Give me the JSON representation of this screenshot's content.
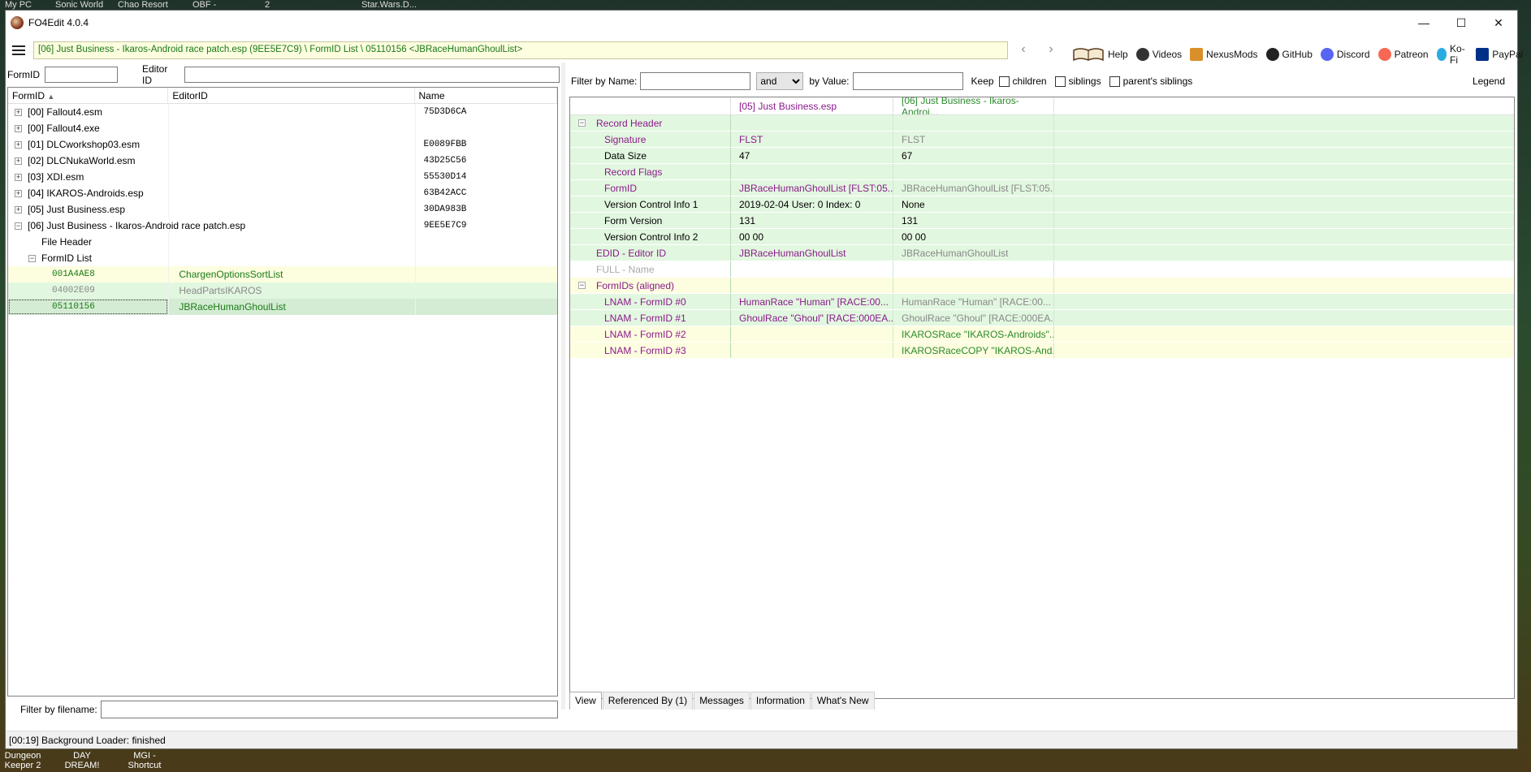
{
  "desktop": {
    "top_labels": [
      "My PC",
      "Sonic World",
      "Chao Resort",
      "OBF -",
      "2",
      "Star.Wars.D..."
    ],
    "bottom_labels": [
      "Dungeon Keeper 2",
      "DAY DREAM!",
      "MGI - Shortcut"
    ]
  },
  "window": {
    "title": "FO4Edit 4.0.4",
    "minimize": "—",
    "maximize": "☐",
    "close": "✕"
  },
  "pathbar": {
    "path": "[06] Just Business - Ikaros-Android race patch.esp (9EE5E7C9) \\ FormID List \\ 05110156 <JBRaceHumanGhoulList>",
    "back": "‹",
    "forward": "›",
    "links": [
      {
        "label": "Help",
        "icon": "book-icon"
      },
      {
        "label": "Videos",
        "icon": "videos-icon"
      },
      {
        "label": "NexusMods",
        "icon": "nexusmods-icon"
      },
      {
        "label": "GitHub",
        "icon": "github-icon"
      },
      {
        "label": "Discord",
        "icon": "discord-icon"
      },
      {
        "label": "Patreon",
        "icon": "patreon-icon"
      },
      {
        "label": "Ko-Fi",
        "icon": "kofi-icon"
      },
      {
        "label": "PayPal",
        "icon": "paypal-icon"
      }
    ]
  },
  "left": {
    "formid_label": "FormID",
    "editorid_label": "Editor ID",
    "formid_value": "",
    "editorid_value": "",
    "columns": [
      "FormID",
      "EditorID",
      "Name"
    ],
    "tree": [
      {
        "exp": "+",
        "label": "[00] Fallout4.esm",
        "editor": "",
        "name": "75D3D6CA",
        "indent": 0,
        "style": ""
      },
      {
        "exp": "+",
        "label": "[00] Fallout4.exe",
        "editor": "",
        "name": "",
        "indent": 0,
        "style": ""
      },
      {
        "exp": "+",
        "label": "[01] DLCworkshop03.esm",
        "editor": "",
        "name": "E0089FBB",
        "indent": 0,
        "style": ""
      },
      {
        "exp": "+",
        "label": "[02] DLCNukaWorld.esm",
        "editor": "",
        "name": "43D25C56",
        "indent": 0,
        "style": ""
      },
      {
        "exp": "+",
        "label": "[03] XDI.esm",
        "editor": "",
        "name": "55530D14",
        "indent": 0,
        "style": ""
      },
      {
        "exp": "+",
        "label": "[04] IKAROS-Androids.esp",
        "editor": "",
        "name": "63B42ACC",
        "indent": 0,
        "style": ""
      },
      {
        "exp": "+",
        "label": "[05] Just Business.esp",
        "editor": "",
        "name": "30DA983B",
        "indent": 0,
        "style": ""
      },
      {
        "exp": "−",
        "label": "[06] Just Business - Ikaros-Android race patch.esp",
        "editor": "",
        "name": "9EE5E7C9",
        "indent": 0,
        "style": ""
      },
      {
        "exp": "",
        "label": "File Header",
        "editor": "",
        "name": "",
        "indent": 1,
        "style": ""
      },
      {
        "exp": "−",
        "label": "FormID List",
        "editor": "",
        "name": "",
        "indent": 1,
        "style": ""
      },
      {
        "exp": "",
        "label": "001A4AE8",
        "editor": "ChargenOptionsSortList",
        "name": "",
        "indent": 2,
        "style": "yellow"
      },
      {
        "exp": "",
        "label": "04002E09",
        "editor": "HeadPartsIKAROS",
        "name": "",
        "indent": 2,
        "style": "green-grey"
      },
      {
        "exp": "",
        "label": "05110156",
        "editor": "JBRaceHumanGhoulList",
        "name": "",
        "indent": 2,
        "style": "selected"
      }
    ],
    "filter_label": "Filter by filename:",
    "filter_value": ""
  },
  "right": {
    "filter_name_label": "Filter by Name:",
    "filter_name_value": "",
    "and_select": "and",
    "filter_value_label": "by Value:",
    "filter_value_value": "",
    "keep_label": "Keep",
    "children_label": "children",
    "siblings_label": "siblings",
    "parents_siblings_label": "parent's siblings",
    "legend_label": "Legend",
    "col_headers": [
      "",
      "[05] Just Business.esp",
      "[06] Just Business - Ikaros-Androi..."
    ],
    "rows": [
      {
        "level": 0,
        "exp": "−",
        "label": "Record Header",
        "v1": "",
        "v2": "",
        "bg": "green",
        "lc": "purple",
        "c1": "",
        "c2": ""
      },
      {
        "level": 1,
        "exp": "",
        "label": "Signature",
        "v1": "FLST",
        "v2": "FLST",
        "bg": "green",
        "lc": "purple",
        "c1": "purple",
        "c2": "grey"
      },
      {
        "level": 1,
        "exp": "",
        "label": "Data Size",
        "v1": "47",
        "v2": "67",
        "bg": "green",
        "lc": "",
        "c1": "",
        "c2": ""
      },
      {
        "level": 1,
        "exp": "",
        "label": "Record Flags",
        "v1": "",
        "v2": "",
        "bg": "green",
        "lc": "purple",
        "c1": "",
        "c2": ""
      },
      {
        "level": 1,
        "exp": "",
        "label": "FormID",
        "v1": "JBRaceHumanGhoulList [FLST:05...",
        "v2": "JBRaceHumanGhoulList [FLST:05...",
        "bg": "green",
        "lc": "purple",
        "c1": "purple",
        "c2": "grey"
      },
      {
        "level": 1,
        "exp": "",
        "label": "Version Control Info 1",
        "v1": "2019-02-04 User: 0 Index: 0",
        "v2": "None",
        "bg": "green",
        "lc": "",
        "c1": "",
        "c2": ""
      },
      {
        "level": 1,
        "exp": "",
        "label": "Form Version",
        "v1": "131",
        "v2": "131",
        "bg": "green",
        "lc": "",
        "c1": "",
        "c2": ""
      },
      {
        "level": 1,
        "exp": "",
        "label": "Version Control Info 2",
        "v1": "00 00",
        "v2": "00 00",
        "bg": "green",
        "lc": "",
        "c1": "",
        "c2": ""
      },
      {
        "level": 0,
        "exp": "",
        "label": "EDID - Editor ID",
        "v1": "JBRaceHumanGhoulList",
        "v2": "JBRaceHumanGhoulList",
        "bg": "green",
        "lc": "purple",
        "c1": "purple",
        "c2": "grey"
      },
      {
        "level": 0,
        "exp": "",
        "label": "FULL - Name",
        "v1": "",
        "v2": "",
        "bg": "white",
        "lc": "grey",
        "c1": "",
        "c2": ""
      },
      {
        "level": 0,
        "exp": "−",
        "label": "FormIDs (aligned)",
        "v1": "",
        "v2": "",
        "bg": "yellow",
        "lc": "purple",
        "c1": "",
        "c2": ""
      },
      {
        "level": 1,
        "exp": "",
        "label": "LNAM - FormID #0",
        "v1": "HumanRace \"Human\" [RACE:00...",
        "v2": "HumanRace \"Human\" [RACE:00...",
        "bg": "green",
        "lc": "purple",
        "c1": "purple",
        "c2": "grey"
      },
      {
        "level": 1,
        "exp": "",
        "label": "LNAM - FormID #1",
        "v1": "GhoulRace \"Ghoul\" [RACE:000EA...",
        "v2": "GhoulRace \"Ghoul\" [RACE:000EA...",
        "bg": "green",
        "lc": "purple",
        "c1": "purple",
        "c2": "grey"
      },
      {
        "level": 1,
        "exp": "",
        "label": "LNAM - FormID #2",
        "v1": "",
        "v2": "IKAROSRace \"IKAROS-Androids\"...",
        "bg": "yellow",
        "lc": "purple",
        "c1": "",
        "c2": "green"
      },
      {
        "level": 1,
        "exp": "",
        "label": "LNAM - FormID #3",
        "v1": "",
        "v2": "IKAROSRaceCOPY \"IKAROS-And...",
        "bg": "yellow",
        "lc": "purple",
        "c1": "",
        "c2": "green"
      }
    ],
    "tabs": [
      "View",
      "Referenced By (1)",
      "Messages",
      "Information",
      "What's New"
    ]
  },
  "status": "[00:19] Background Loader: finished"
}
